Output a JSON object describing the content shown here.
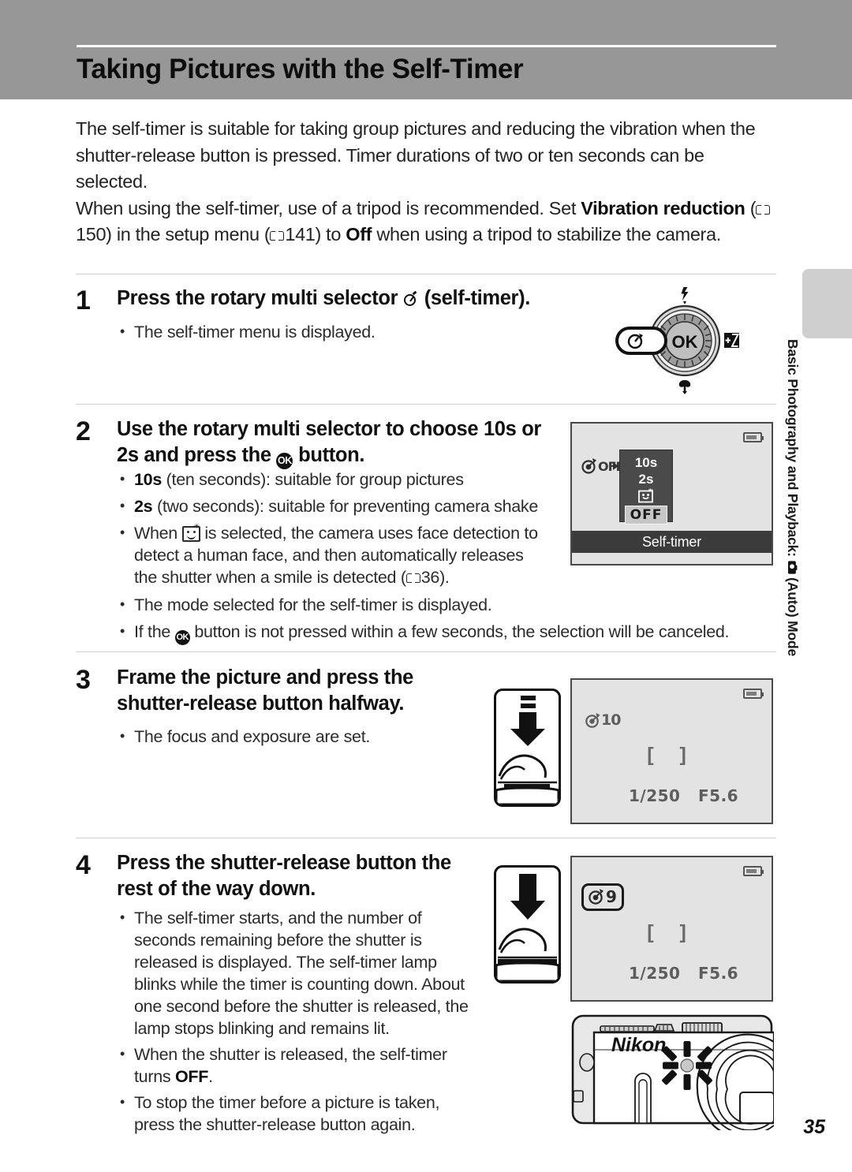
{
  "page": {
    "title": "Taking Pictures with the Self-Timer",
    "number": "35",
    "side_tab": "Basic Photography and Playback:  (Auto) Mode"
  },
  "intro": {
    "para1_a": "The self-timer is suitable for taking group pictures and reducing the vibration when the shutter-release button is pressed. Timer durations of two or ten seconds can be selected.",
    "para2_a": "When using the self-timer, use of a tripod is recommended. Set ",
    "para2_b": "Vibration reduction",
    "para2_c": " (",
    "para2_ref1": "150",
    "para2_d": ") in the setup menu (",
    "para2_ref2": "141",
    "para2_e": ") to ",
    "para2_f": "Off",
    "para2_g": " when using a tripod to stabilize the camera."
  },
  "steps": [
    {
      "number": "1",
      "heading_a": "Press the rotary multi selector ",
      "heading_b": " (self-timer).",
      "bullets": [
        {
          "text": "The self-timer menu is displayed."
        }
      ]
    },
    {
      "number": "2",
      "heading_a": "Use the rotary multi selector to choose ",
      "heading_b": "10s",
      "heading_c": " or ",
      "heading_d": "2s",
      "heading_e": " and press the ",
      "heading_f": " button.",
      "bullets": [
        {
          "bold": "10s",
          "text": " (ten seconds): suitable for group pictures"
        },
        {
          "bold": "2s",
          "text": " (two seconds): suitable for preventing camera shake"
        },
        {
          "text_a": "When ",
          "text_b": " is selected, the camera uses face detection to detect a human face, and then automatically releases the shutter when a smile is detected (",
          "ref": "36",
          "text_c": ")."
        },
        {
          "text": "The mode selected for the self-timer is displayed."
        },
        {
          "text_a": "If the ",
          "text_b": " button is not pressed within a few seconds, the selection will be canceled."
        }
      ]
    },
    {
      "number": "3",
      "heading": "Frame the picture and press the shutter-release button halfway.",
      "bullets": [
        {
          "text": "The focus and exposure are set."
        }
      ]
    },
    {
      "number": "4",
      "heading": "Press the shutter-release button the rest of the way down.",
      "bullets": [
        {
          "text": "The self-timer starts, and the number of seconds remaining before the shutter is released is displayed. The self-timer lamp blinks while the timer is counting down. About one second before the shutter is released, the lamp stops blinking and remains lit."
        },
        {
          "text_a": "When the shutter is released, the self-timer turns ",
          "bold": "OFF",
          "text_b": "."
        },
        {
          "text": "To stop the timer before a picture is taken, press the shutter-release button again."
        }
      ]
    }
  ],
  "rotary_selector": {
    "center_label": "OK",
    "top_icon": "flash-icon",
    "left_icon": "self-timer-icon",
    "right_icon": "exposure-compensation-icon",
    "bottom_icon": "macro-icon"
  },
  "lcd_menu": {
    "indicator": "OFF",
    "options": [
      "10s",
      "2s"
    ],
    "smile_option": "smile-timer-icon",
    "selected": "OFF",
    "title": "Self-timer",
    "battery": "battery-icon"
  },
  "lcd_step3": {
    "self_timer_indicator": "10",
    "shutter_speed": "1/250",
    "aperture": "F5.6",
    "battery": "battery-icon",
    "focus_area": "focus-brackets"
  },
  "lcd_step4": {
    "self_timer_indicator": "9",
    "shutter_speed": "1/250",
    "aperture": "F5.6",
    "battery": "battery-icon",
    "focus_area": "focus-brackets"
  },
  "camera_illustration": {
    "brand": "Nikon",
    "lamp": "self-timer-lamp-blinking"
  },
  "colors": {
    "header_band": "#979797",
    "side_tab": "#cfcfcf",
    "lcd_background": "#e3e3e3",
    "menu_popup": "#4a4a4a",
    "title_bar": "#3b3b3b"
  }
}
